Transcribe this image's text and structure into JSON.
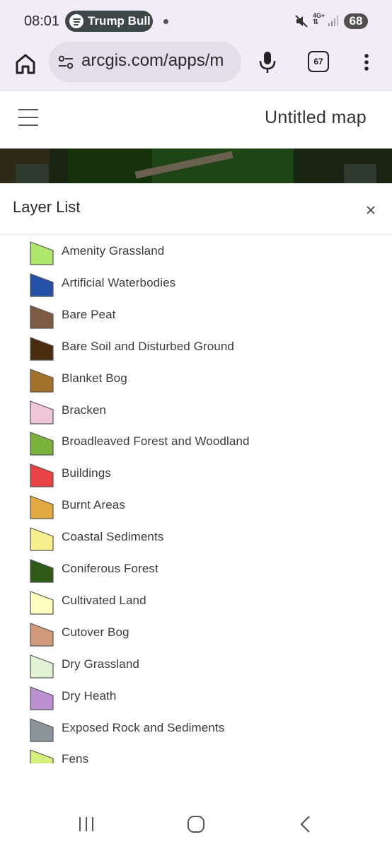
{
  "status_bar": {
    "time": "08:01",
    "now_playing": "Trump Bull",
    "network": "4G+",
    "battery": "68"
  },
  "browser": {
    "url": "arcgis.com/apps/m",
    "tab_count": "67",
    "icons": [
      "home-icon",
      "site-settings-icon",
      "mic-icon",
      "tabs-icon",
      "more-icon"
    ]
  },
  "app": {
    "map_title": "Untitled map"
  },
  "layer_panel": {
    "title": "Layer List",
    "close_icon": "close-icon",
    "layers": [
      {
        "label": "Amenity Grassland",
        "color": "#aee86a"
      },
      {
        "label": "Artificial Waterbodies",
        "color": "#2450a8"
      },
      {
        "label": "Bare Peat",
        "color": "#7f5a43"
      },
      {
        "label": "Bare Soil and Disturbed Ground",
        "color": "#4a2c0e"
      },
      {
        "label": "Blanket Bog",
        "color": "#a2722a"
      },
      {
        "label": "Bracken",
        "color": "#f0c6d8"
      },
      {
        "label": "Broadleaved Forest and Woodland",
        "color": "#79b23a"
      },
      {
        "label": "Buildings",
        "color": "#e84244"
      },
      {
        "label": "Burnt Areas",
        "color": "#e2a940"
      },
      {
        "label": "Coastal Sediments",
        "color": "#f6f08e"
      },
      {
        "label": "Coniferous Forest",
        "color": "#2f5a17"
      },
      {
        "label": "Cultivated Land",
        "color": "#fdfdbd"
      },
      {
        "label": "Cutover Bog",
        "color": "#d19a7a"
      },
      {
        "label": "Dry Grassland",
        "color": "#e2f3d4"
      },
      {
        "label": "Dry Heath",
        "color": "#bb8fd0"
      },
      {
        "label": "Exposed Rock and Sediments",
        "color": "#8a959a"
      },
      {
        "label": "Fens",
        "color": "#d6f07c"
      }
    ]
  },
  "nav_bar": {
    "icons": [
      "recents-icon",
      "home-nav-icon",
      "back-icon"
    ]
  }
}
